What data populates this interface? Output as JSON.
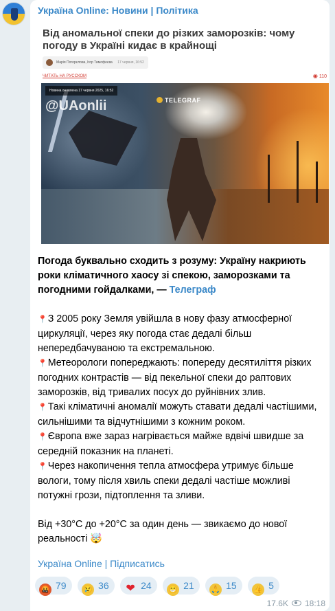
{
  "channel": {
    "title": "Україна Online: Новини | Політика",
    "subscribe_link": "Україна Online | Підписатись"
  },
  "article": {
    "title": "Від аномальної спеки до різких заморозків: чому погоду в Україні кидає в крайнощі",
    "authors": "Марія Погорєлова, Ігор Тимофеєва",
    "date": "17 червня, 16:52",
    "read_ru": "ЧИТАТЬ НА РУССКОМ",
    "views": "110",
    "image": {
      "caption": "Новина оновлена 17 червня 2025, 16:52",
      "watermark": "@UAonlii",
      "source_logo": "TELEGRAF"
    }
  },
  "post": {
    "lead": "Погода буквально сходить з розуму: Україну накриють роки кліматичного хаосу зі спекою, заморозками та погодними гойдалками, —",
    "lead_link": "Телеграф",
    "bullets": [
      "З 2005 року Земля увійшла в нову фазу атмосферної циркуляції, через яку погода стає дедалі більш непередбачуваною та екстремальною.",
      "Метеорологи попереджають: попереду десятиліття різких погодних контрастів — від пекельної спеки до раптових заморозків, від тривалих посух до руйнівних злив.",
      "Такі кліматичні аномалії можуть ставати дедалі частішими, сильнішими та відчутнішими з кожним роком.",
      "Європа вже зараз нагрівається майже вдвічі швидше за середній показник на планеті.",
      "Через накопичення тепла атмосфера утримує більше вологи, тому після хвиль спеки дедалі частіше можливі потужні грози, підтоплення та зливи."
    ],
    "closing": "Від +30°C до +20°C за один день — звикаємо до нової реальності",
    "closing_emoji": "🤯"
  },
  "reactions": [
    {
      "icon": "angry-face-icon",
      "emoji": "🤬",
      "count": "79",
      "color": "#e0582c"
    },
    {
      "icon": "crying-face-icon",
      "emoji": "😢",
      "count": "36",
      "color": "#f2c43a"
    },
    {
      "icon": "heart-icon",
      "emoji": "❤",
      "count": "24",
      "color": "#e0242e"
    },
    {
      "icon": "grinning-face-icon",
      "emoji": "😁",
      "count": "21",
      "color": "#f2c43a"
    },
    {
      "icon": "praying-hands-icon",
      "emoji": "🙏",
      "count": "15",
      "color": "#f2c43a"
    },
    {
      "icon": "thumbs-up-icon",
      "emoji": "👍",
      "count": "5",
      "color": "#f2c43a"
    }
  ],
  "footer": {
    "views": "17.6K",
    "time": "18:18"
  }
}
